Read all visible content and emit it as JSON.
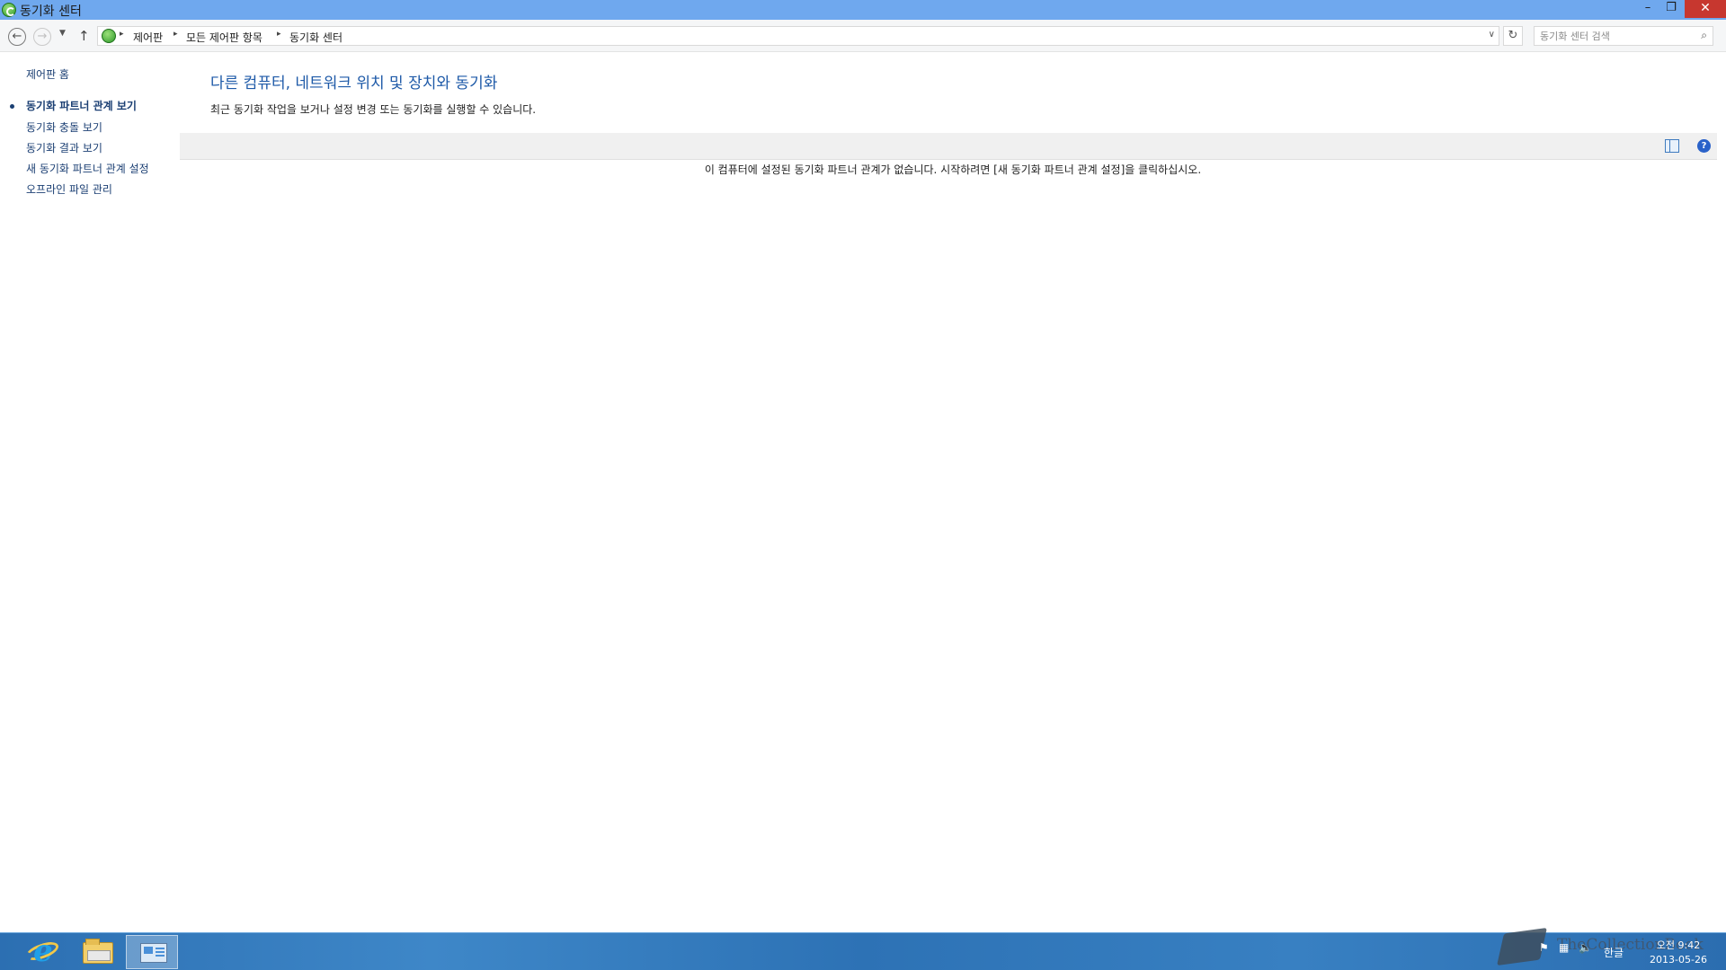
{
  "window": {
    "title": "동기화 센터",
    "min_glyph": "–",
    "max_glyph": "❐",
    "close_glyph": "✕"
  },
  "nav": {
    "back_glyph": "←",
    "forward_glyph": "→",
    "recent_glyph": "▼",
    "up_glyph": "↑",
    "breadcrumb": [
      "제어판",
      "모든 제어판 항목",
      "동기화 센터"
    ],
    "separator": "▸",
    "dropdown_glyph": "∨",
    "refresh_glyph": "↻",
    "search_placeholder": "동기화 센터 검색",
    "search_glyph": "⌕"
  },
  "sidebar": {
    "home": "제어판 홈",
    "items": [
      {
        "label": "동기화 파트너 관계 보기",
        "active": true
      },
      {
        "label": "동기화 충돌 보기",
        "active": false
      },
      {
        "label": "동기화 결과 보기",
        "active": false
      },
      {
        "label": "새 동기화 파트너 관계 설정",
        "active": false
      },
      {
        "label": "오프라인 파일 관리",
        "active": false
      }
    ]
  },
  "main": {
    "heading": "다른 컴퓨터, 네트워크 위치 및 장치와 동기화",
    "subtext": "최근 동기화 작업을 보거나 설정 변경 또는 동기화를 실행할 수 있습니다.",
    "help_glyph": "?",
    "empty_message": "이 컴퓨터에 설정된 동기화 파트너 관계가 없습니다. 시작하려면 [새 동기화 파트너 관계 설정]을 클릭하십시오."
  },
  "taskbar": {
    "ie_glyph": "e",
    "tray_flag_glyph": "⚑",
    "tray_net_glyph": "▦",
    "tray_volume_glyph": "🔈",
    "ime_label": "한글",
    "time": "오전 9:42",
    "date": "2013-05-26"
  },
  "watermark": {
    "text": "TheCollectionBook"
  },
  "colors": {
    "titlebar": "#6fa8ee",
    "close_button": "#c7372f",
    "link": "#1b3f73",
    "heading": "#1e5aa8",
    "taskbar": "#2c6fb2"
  }
}
